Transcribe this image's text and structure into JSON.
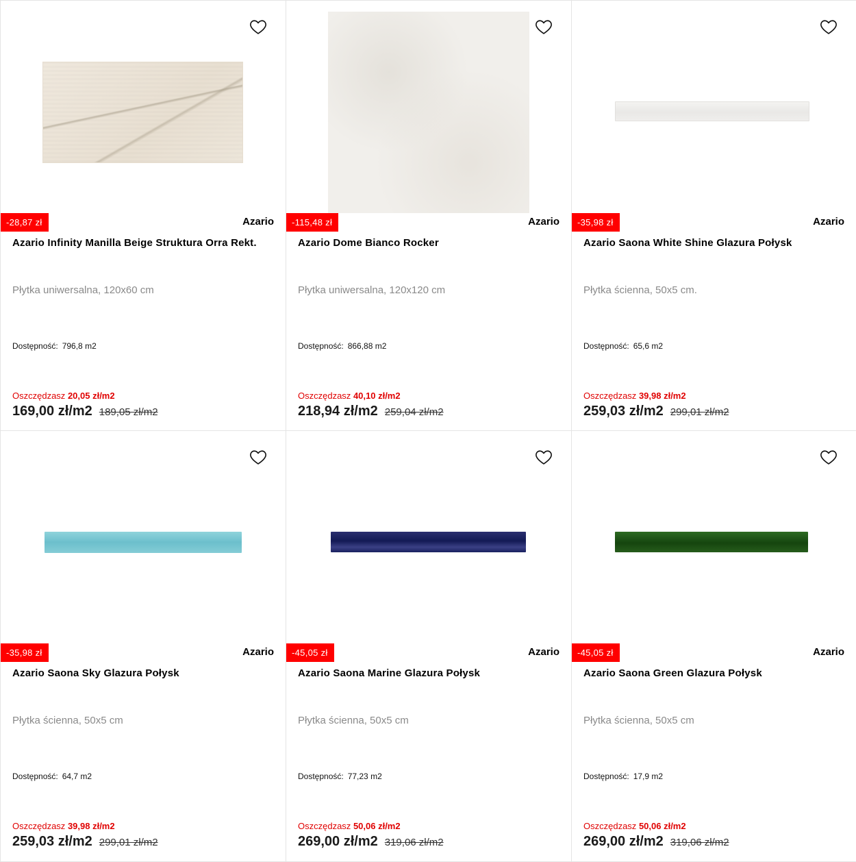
{
  "products": [
    {
      "discount": "-28,87 zł",
      "brand": "Azario",
      "title": "Azario Infinity Manilla Beige Struktura Orra Rekt.",
      "subtitle": "Płytka uniwersalna, 120x60 cm",
      "availability_label": "Dostępność:",
      "availability_value": "796,8 m2",
      "savings_label": "Oszczędzasz",
      "savings_amount": "20,05 zł/m2",
      "price": "169,00 zł/m2",
      "old_price": "189,05 zł/m2"
    },
    {
      "discount": "-115,48 zł",
      "brand": "Azario",
      "title": "Azario Dome Bianco Rocker",
      "subtitle": "Płytka uniwersalna, 120x120 cm",
      "availability_label": "Dostępność:",
      "availability_value": "866,88 m2",
      "savings_label": "Oszczędzasz",
      "savings_amount": "40,10 zł/m2",
      "price": "218,94 zł/m2",
      "old_price": "259,04 zł/m2"
    },
    {
      "discount": "-35,98 zł",
      "brand": "Azario",
      "title": "Azario Saona White Shine Glazura Połysk",
      "subtitle": "Płytka ścienna, 50x5 cm.",
      "availability_label": "Dostępność:",
      "availability_value": "65,6 m2",
      "savings_label": "Oszczędzasz",
      "savings_amount": "39,98 zł/m2",
      "price": "259,03 zł/m2",
      "old_price": "299,01 zł/m2"
    },
    {
      "discount": "-35,98 zł",
      "brand": "Azario",
      "title": "Azario Saona Sky Glazura Połysk",
      "subtitle": "Płytka ścienna, 50x5 cm",
      "availability_label": "Dostępność:",
      "availability_value": "64,7 m2",
      "savings_label": "Oszczędzasz",
      "savings_amount": "39,98 zł/m2",
      "price": "259,03 zł/m2",
      "old_price": "299,01 zł/m2"
    },
    {
      "discount": "-45,05 zł",
      "brand": "Azario",
      "title": "Azario Saona Marine Glazura Połysk",
      "subtitle": "Płytka ścienna, 50x5 cm",
      "availability_label": "Dostępność:",
      "availability_value": "77,23 m2",
      "savings_label": "Oszczędzasz",
      "savings_amount": "50,06 zł/m2",
      "price": "269,00 zł/m2",
      "old_price": "319,06 zł/m2"
    },
    {
      "discount": "-45,05 zł",
      "brand": "Azario",
      "title": "Azario Saona Green Glazura Połysk",
      "subtitle": "Płytka ścienna, 50x5 cm",
      "availability_label": "Dostępność:",
      "availability_value": "17,9 m2",
      "savings_label": "Oszczędzasz",
      "savings_amount": "50,06 zł/m2",
      "price": "269,00 zł/m2",
      "old_price": "319,06 zł/m2"
    }
  ],
  "colors": {
    "discount_badge": "#ff0000",
    "savings_text": "#e00000",
    "border": "#e4e4e4"
  },
  "icons": {
    "favorite": "heart-outline-icon"
  }
}
